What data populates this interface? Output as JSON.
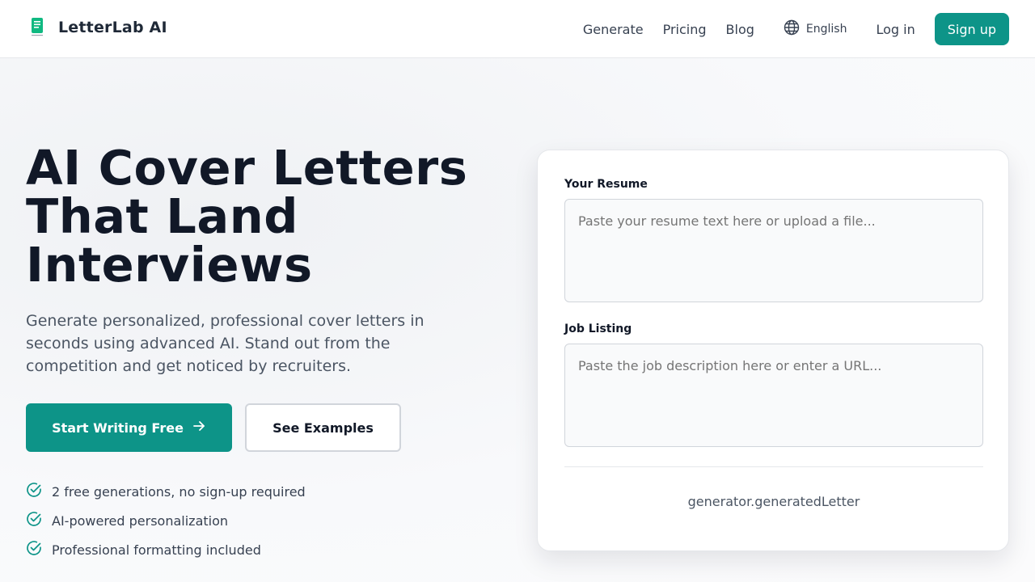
{
  "header": {
    "brand": "LetterLab AI",
    "nav": [
      "Generate",
      "Pricing",
      "Blog"
    ],
    "language": "English",
    "login": "Log in",
    "signup": "Sign up"
  },
  "hero": {
    "title_lines": [
      "AI Cover Letters",
      "That Land",
      "Interviews"
    ],
    "subtitle": "Generate personalized, professional cover letters in seconds using advanced AI. Stand out from the competition and get noticed by recruiters.",
    "primary_cta": "Start Writing Free",
    "secondary_cta": "See Examples",
    "features": [
      "2 free generations, no sign-up required",
      "AI-powered personalization",
      "Professional formatting included"
    ]
  },
  "generator": {
    "resume_label": "Your Resume",
    "resume_placeholder": "Paste your resume text here or upload a file...",
    "job_label": "Job Listing",
    "job_placeholder": "Paste the job description here or enter a URL...",
    "output_text": "generator.generatedLetter"
  },
  "colors": {
    "accent": "#0d9488",
    "heading": "#111827",
    "body_text": "#4b5563"
  },
  "icons": [
    "logo-icon",
    "globe-icon",
    "arrow-right-icon",
    "check-circle-icon"
  ]
}
